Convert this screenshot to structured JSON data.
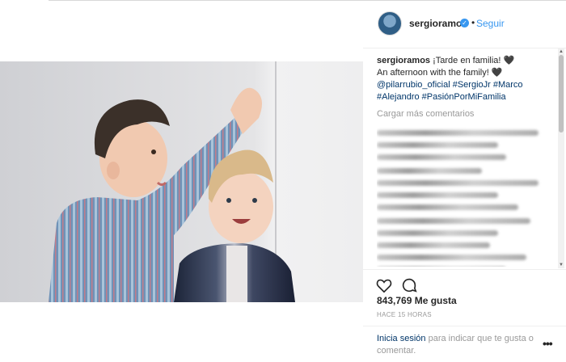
{
  "post": {
    "username": "sergioramos",
    "follow_label": "Seguir",
    "verified_glyph": "✓",
    "dot": "•",
    "caption_user": "sergioramos",
    "caption_line1": "¡Tarde en familia! 🖤",
    "caption_line2": "An afternoon with the family! 🖤",
    "tags": [
      "@pilarrubio_oficial",
      "#SergioJr",
      "#Marco",
      "#Alejandro",
      "#PasiónPorMiFamilia"
    ],
    "load_more": "Cargar más comentarios",
    "likes": "843,769 Me gusta",
    "time": "HACE 15 HORAS",
    "login_link": "Inicia sesión",
    "login_rest": " para indicar que te gusta o comentar.",
    "more_glyph": "•••"
  },
  "icons": {
    "like": "heart-icon",
    "comment": "speech-bubble-icon",
    "verified": "verified-badge-icon"
  },
  "colors": {
    "link": "#3897f0",
    "tag": "#003569",
    "muted": "#999999"
  }
}
